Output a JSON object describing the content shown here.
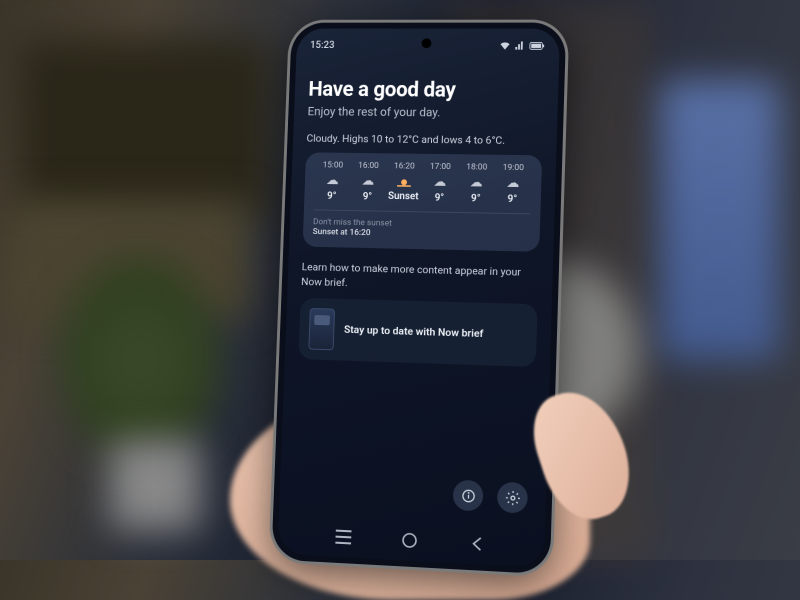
{
  "status_bar": {
    "time": "15:23"
  },
  "content": {
    "greeting": "Have a good day",
    "subtitle": "Enjoy the rest of your day.",
    "forecast_summary": "Cloudy. Highs 10 to 12°C and lows 4 to 6°C."
  },
  "weather": {
    "hours": [
      {
        "time": "15:00",
        "icon": "☁",
        "temp": "9°"
      },
      {
        "time": "16:00",
        "icon": "☁",
        "temp": "9°"
      },
      {
        "time": "16:20",
        "icon": "sunset",
        "temp": "Sunset"
      },
      {
        "time": "17:00",
        "icon": "☁",
        "temp": "9°"
      },
      {
        "time": "18:00",
        "icon": "☁",
        "temp": "9°"
      },
      {
        "time": "19:00",
        "icon": "☁",
        "temp": "9°"
      }
    ],
    "sunset_label": "Don't miss the sunset",
    "sunset_time": "Sunset at 16:20"
  },
  "learn": {
    "text": "Learn how to make more content appear in your Now brief.",
    "card_title": "Stay up to date with Now brief"
  }
}
